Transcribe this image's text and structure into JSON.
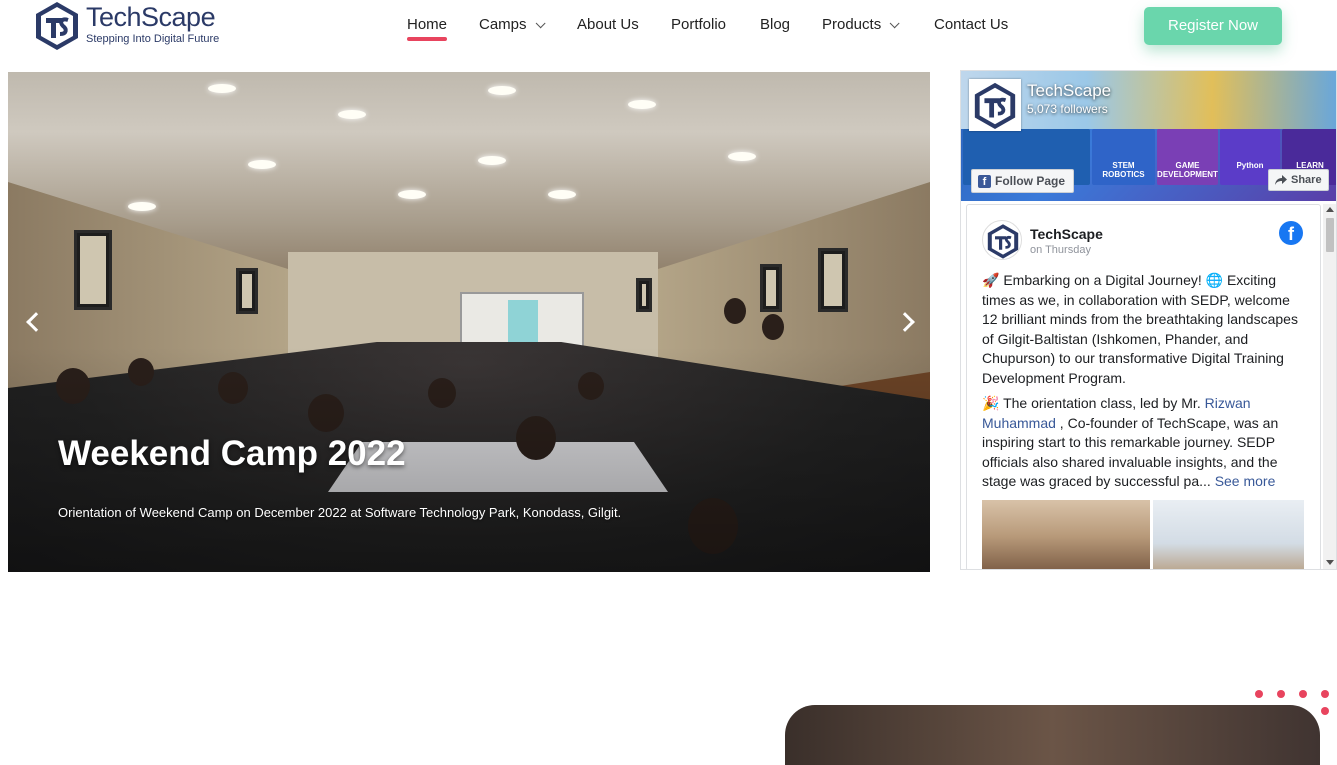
{
  "header": {
    "logo": {
      "name": "TechScape",
      "tagline": "Stepping Into Digital Future"
    },
    "nav": [
      {
        "label": "Home",
        "active": true,
        "dropdown": false
      },
      {
        "label": "Camps",
        "active": false,
        "dropdown": true
      },
      {
        "label": "About Us",
        "active": false,
        "dropdown": false
      },
      {
        "label": "Portfolio",
        "active": false,
        "dropdown": false
      },
      {
        "label": "Blog",
        "active": false,
        "dropdown": false
      },
      {
        "label": "Products",
        "active": false,
        "dropdown": true
      },
      {
        "label": "Contact Us",
        "active": false,
        "dropdown": false
      }
    ],
    "register_label": "Register Now"
  },
  "slider": {
    "title": "Weekend Camp 2022",
    "caption": "Orientation of Weekend Camp on December 2022 at Software Technology Park, Konodass, Gilgit."
  },
  "facebook": {
    "page_name": "TechScape",
    "followers": "5,073 followers",
    "follow_label": "Follow Page",
    "share_label": "Share",
    "cover_tiles": [
      "STEM ROBOTICS",
      "GAME DEVELOPMENT",
      "Python",
      "LEARN"
    ],
    "post": {
      "author": "TechScape",
      "time": "on Thursday",
      "paragraph1": "🚀 Embarking on a Digital Journey! 🌐 Exciting times as we, in collaboration with SEDP, welcome 12 brilliant minds from the breathtaking landscapes of Gilgit-Baltistan (Ishkomen, Phander, and Chupurson) to our transformative Digital Training Development Program.",
      "paragraph2_start": "🎉 The orientation class, led by Mr. ",
      "mention": "Rizwan Muhammad",
      "paragraph2_end": " , Co-founder of TechScape, was an inspiring start to this remarkable journey. SEDP officials also shared invaluable insights, and the stage was graced by successful pa... ",
      "see_more": "See more"
    }
  },
  "colors": {
    "brand_navy": "#2b3a67",
    "accent_red": "#e8445e",
    "register_green": "#6ad6ac",
    "facebook_blue": "#1877f2"
  }
}
